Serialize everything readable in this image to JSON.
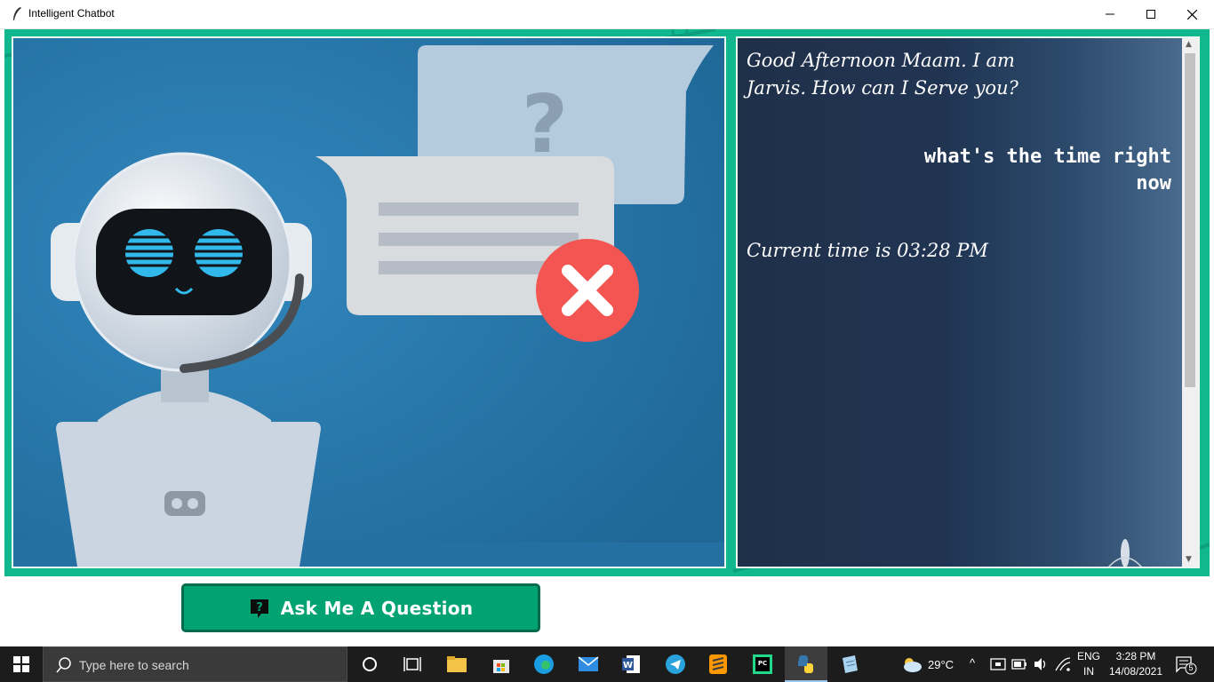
{
  "window": {
    "title": "Intelligent Chatbot",
    "controls": [
      "minimize-icon",
      "maximize-icon",
      "close-icon"
    ]
  },
  "illustration": {
    "question_mark": "?"
  },
  "chat": {
    "messages": [
      {
        "sender": "bot",
        "text": "Good Afternoon Maam. I am Jarvis. How can I Serve you?"
      },
      {
        "sender": "user",
        "text": "what's the time right now"
      },
      {
        "sender": "bot",
        "text": "Current time is 03:28 PM"
      }
    ]
  },
  "ask_button": {
    "label": "Ask Me A Question",
    "icon": "question-bubble-icon"
  },
  "taskbar": {
    "search_placeholder": "Type here to search",
    "apps": [
      "cortana-icon",
      "task-view-icon",
      "file-explorer-icon",
      "store-icon",
      "edge-icon",
      "mail-icon",
      "word-icon",
      "telegram-icon",
      "sublime-text-icon",
      "pycharm-icon",
      "python-icon",
      "notepad-icon"
    ],
    "weather": "29°C",
    "language_top": "ENG",
    "language_bottom": "IN",
    "time": "3:28 PM",
    "date": "14/08/2021",
    "notifications": "5"
  },
  "colors": {
    "frame_green": "#11b78d",
    "button_green": "#03a273",
    "chat_bg": "#203452",
    "illustration_bg": "#2a7cb0"
  }
}
